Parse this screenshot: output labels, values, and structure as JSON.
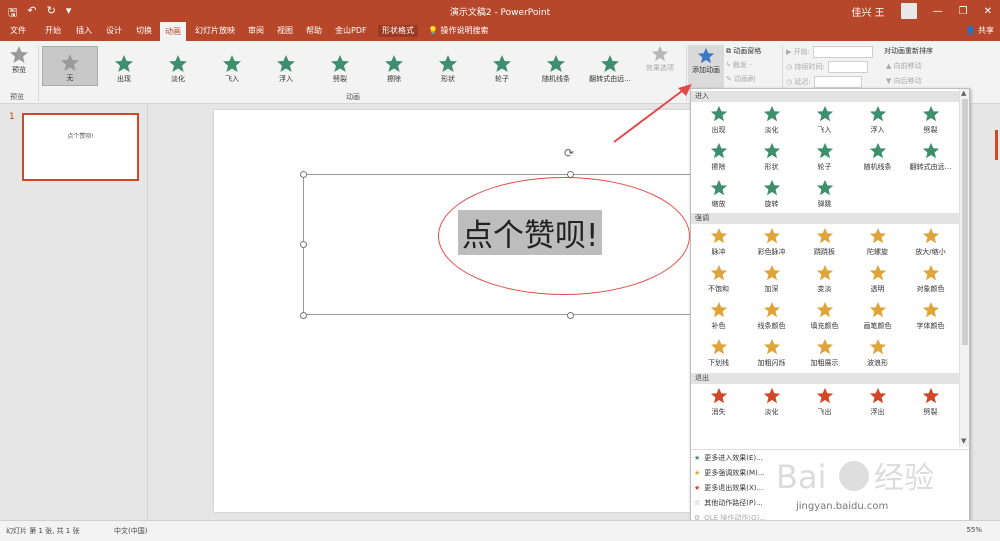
{
  "titlebar": {
    "title": "演示文稿2  -  PowerPoint",
    "user": "佳兴 王",
    "min": "—",
    "restore": "❐",
    "close": "✕"
  },
  "tabs": [
    {
      "label": "文件"
    },
    {
      "label": "开始"
    },
    {
      "label": "插入"
    },
    {
      "label": "设计"
    },
    {
      "label": "切换"
    },
    {
      "label": "动画"
    },
    {
      "label": "幻灯片放映"
    },
    {
      "label": "审阅"
    },
    {
      "label": "视图"
    },
    {
      "label": "帮助"
    },
    {
      "label": "金山PDF"
    },
    {
      "label": "形状格式"
    },
    {
      "label": "操作说明搜索"
    }
  ],
  "share": "共享",
  "ribbon": {
    "preview": "预览",
    "preview_group": "预览",
    "animation_group": "动画",
    "effects": [
      "无",
      "出现",
      "淡化",
      "飞入",
      "浮入",
      "劈裂",
      "擦除",
      "形状",
      "轮子",
      "随机线条",
      "翻转式由远..."
    ],
    "effect_options": "效果选项",
    "add_animation": "添加动画",
    "pane": "动画窗格",
    "trigger": "触发 -",
    "painter": "动画刷",
    "start": "开始:",
    "duration": "持续时间:",
    "delay": "延迟:",
    "reorder": "对动画重新排序",
    "move_earlier": "▲ 向前移动",
    "move_later": "▼ 向后移动"
  },
  "thumbnail": {
    "number": "1",
    "text": "点个赞呗!"
  },
  "slide": {
    "text": "点个赞呗!"
  },
  "gallery": {
    "entrance": {
      "title": "进入",
      "items": [
        "出现",
        "淡化",
        "飞入",
        "浮入",
        "劈裂",
        "擦除",
        "形状",
        "轮子",
        "随机线条",
        "翻转式由远...",
        "缩放",
        "旋转",
        "弹跳"
      ]
    },
    "emphasis": {
      "title": "强调",
      "items": [
        "脉冲",
        "彩色脉冲",
        "跷跷板",
        "陀螺旋",
        "放大/缩小",
        "不饱和",
        "加深",
        "变淡",
        "透明",
        "对象颜色",
        "补色",
        "线条颜色",
        "填充颜色",
        "画笔颜色",
        "字体颜色",
        "下划线",
        "加粗闪烁",
        "加粗展示",
        "波浪形"
      ]
    },
    "exit": {
      "title": "退出",
      "items": [
        "消失",
        "淡化",
        "飞出",
        "浮出",
        "劈裂"
      ]
    },
    "more": [
      "更多进入效果(E)...",
      "更多强调效果(M)...",
      "更多退出效果(X)...",
      "其他动作路径(P)...",
      "OLE 操作动作(O)..."
    ]
  },
  "statusbar": {
    "slide_info": "幻灯片 第 1 张, 共 1 张",
    "language": "中文(中国)",
    "zoom": "55%"
  },
  "watermark": {
    "url": "jingyan.baidu.com"
  },
  "colors": {
    "brand": "#b7472a",
    "entrance": "#3d8f6e",
    "emphasis": "#e0a53a",
    "exit": "#d24726"
  }
}
